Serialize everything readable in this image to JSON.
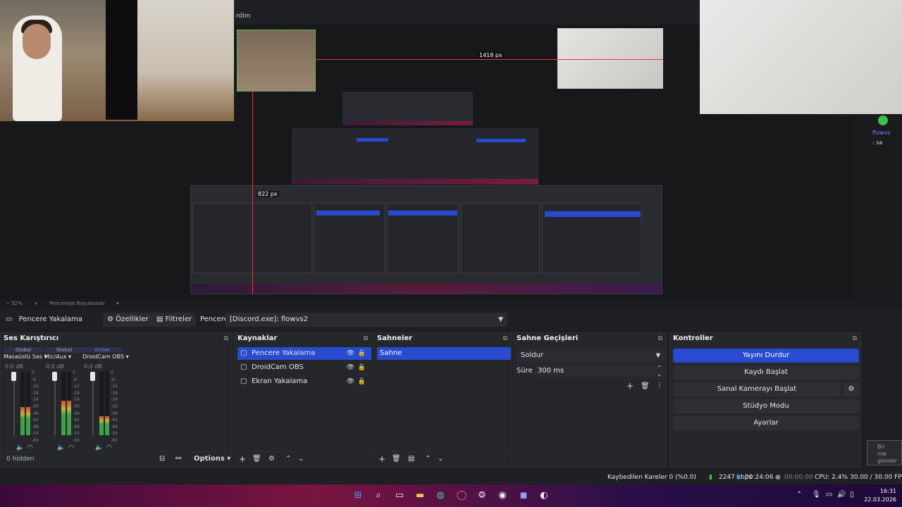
{
  "preview": {
    "window_partial_title": "rdim",
    "measure_horizontal": "1418 px",
    "measure_vertical": "822 px",
    "chat_name": "flowvs",
    "chat_msg": ": sa"
  },
  "zoom_bar": {
    "zoom": "− 52%",
    "plus": "+",
    "fit_label": "Pencereye Boyutlandır"
  },
  "properties_bar": {
    "source_name": "Pencere Yakalama",
    "properties_label": "Özellikler",
    "filters_label": "Filtreler",
    "window_label": "Pencere",
    "window_value": "[Discord.exe]: flowvs2"
  },
  "mixer": {
    "title": "Ses Karıştırıcı",
    "footer_hidden": "0 hidden",
    "options_label": "Options",
    "channels": [
      {
        "tab": "Global",
        "name": "Masaüstü Ses",
        "db": "0.0 dB",
        "level": 0.45
      },
      {
        "tab": "Global",
        "name": "Mic/Aux",
        "db": "0.0 dB",
        "level": 0.55
      },
      {
        "tab": "Active",
        "name": "DroidCam OBS",
        "db": "0.0 dB",
        "level": 0.3
      }
    ],
    "scale": [
      "0",
      "-6",
      "-12",
      "-18",
      "-24",
      "-30",
      "-36",
      "-42",
      "-48",
      "-54",
      "-60"
    ]
  },
  "sources": {
    "title": "Kaynaklar",
    "items": [
      {
        "name": "Pencere Yakalama",
        "selected": true
      },
      {
        "name": "DroidCam OBS",
        "selected": false
      },
      {
        "name": "Ekran Yakalama",
        "selected": false
      }
    ]
  },
  "scenes": {
    "title": "Sahneler",
    "items": [
      "Sahne"
    ]
  },
  "transitions": {
    "title": "Sahne Geçişleri",
    "selected": "Soldur",
    "duration_label": "Süre",
    "duration_value": "300 ms"
  },
  "controls": {
    "title": "Kontroller",
    "buttons": [
      "Yayını Durdur",
      "Kaydı Başlat",
      "Sanal Kamerayı Başlat",
      "Stüdyo Modu",
      "Ayarlar"
    ]
  },
  "status": {
    "dropped": "Kaybedilen Kareler 0 (%0.0)",
    "bitrate": "2247 kbps",
    "live_time": "00:24:06",
    "rec_time": "00:00:00",
    "cpu": "CPU: 2.4%",
    "fps": "30.00 / 30.00 FPS"
  },
  "toast": {
    "line1": "Bir",
    "line2": "me",
    "line3": "gönder"
  },
  "clock": {
    "time": "16:31",
    "date": "22.03.2026"
  },
  "colors": {
    "accent": "#284bd0",
    "panel_bg": "#26272b",
    "app_bg": "#1e1f22"
  }
}
